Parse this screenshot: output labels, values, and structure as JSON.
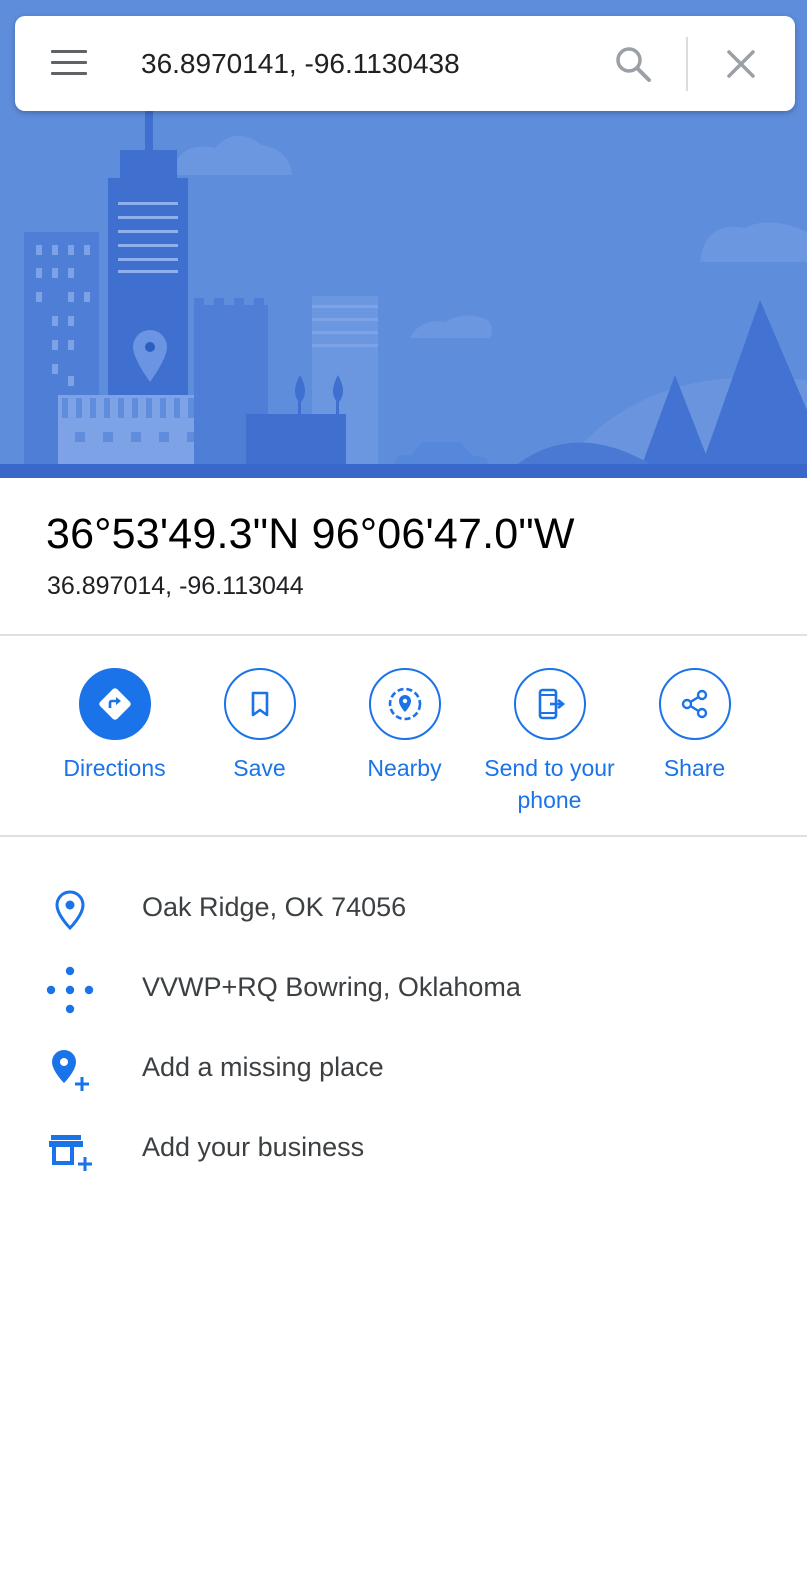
{
  "search": {
    "value": "36.8970141, -96.1130438"
  },
  "place": {
    "dms": "36°53'49.3\"N 96°06'47.0\"W",
    "decimal": "36.897014, -96.113044"
  },
  "actions": [
    {
      "label": "Directions",
      "icon": "directions-icon"
    },
    {
      "label": "Save",
      "icon": "bookmark-icon"
    },
    {
      "label": "Nearby",
      "icon": "nearby-icon"
    },
    {
      "label": "Send to your phone",
      "icon": "send-to-phone-icon"
    },
    {
      "label": "Share",
      "icon": "share-icon"
    }
  ],
  "info": [
    {
      "text": "Oak Ridge, OK 74056",
      "icon": "location-pin-icon"
    },
    {
      "text": "VVWP+RQ Bowring, Oklahoma",
      "icon": "plus-code-icon"
    },
    {
      "text": "Add a missing place",
      "icon": "add-place-icon"
    },
    {
      "text": "Add your business",
      "icon": "add-business-icon"
    }
  ],
  "colors": {
    "accent": "#1a73e8",
    "hero_background": "#5e8ddc"
  }
}
